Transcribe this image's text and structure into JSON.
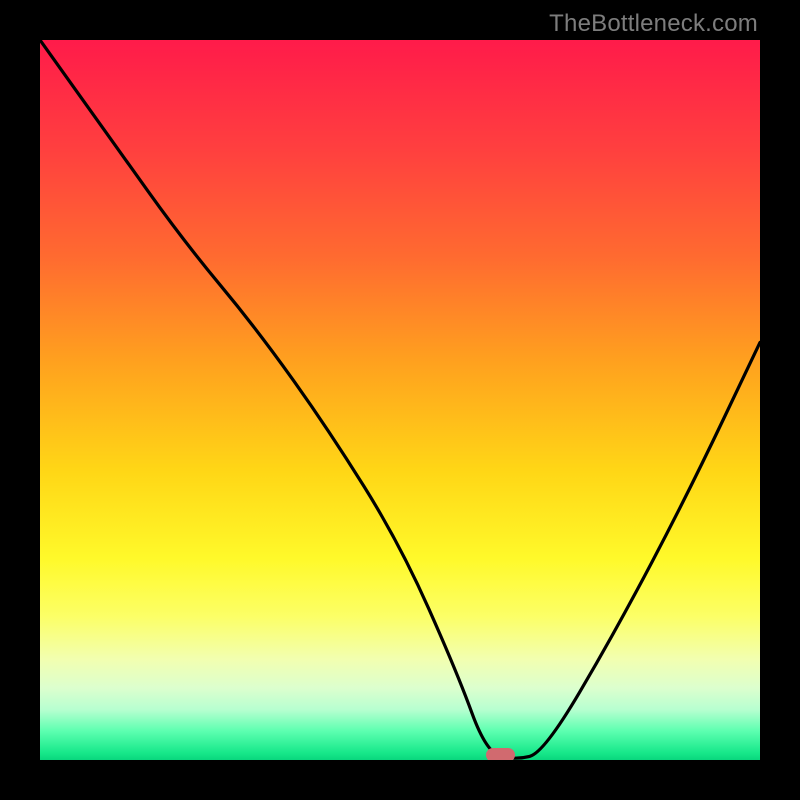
{
  "watermark": "TheBottleneck.com",
  "chart_data": {
    "type": "line",
    "title": "",
    "xlabel": "",
    "ylabel": "",
    "xlim": [
      0,
      100
    ],
    "ylim": [
      0,
      100
    ],
    "series": [
      {
        "name": "bottleneck-curve",
        "x": [
          0,
          10,
          20,
          30,
          40,
          50,
          58,
          62,
          66,
          70,
          80,
          90,
          100
        ],
        "y": [
          100,
          86,
          72,
          60,
          46,
          30,
          12,
          1,
          0,
          1,
          18,
          37,
          58
        ]
      }
    ],
    "optimal_marker": {
      "x": 64,
      "width": 4,
      "y": 0
    },
    "gradient_stops": [
      {
        "pct": 0,
        "color": "#ff1b4a"
      },
      {
        "pct": 15,
        "color": "#ff3f3f"
      },
      {
        "pct": 30,
        "color": "#ff6a30"
      },
      {
        "pct": 45,
        "color": "#ffa21e"
      },
      {
        "pct": 60,
        "color": "#ffd716"
      },
      {
        "pct": 72,
        "color": "#fff92a"
      },
      {
        "pct": 80,
        "color": "#fcff66"
      },
      {
        "pct": 86,
        "color": "#f2ffb0"
      },
      {
        "pct": 90,
        "color": "#dcffce"
      },
      {
        "pct": 93,
        "color": "#b7ffd0"
      },
      {
        "pct": 96,
        "color": "#5cffb0"
      },
      {
        "pct": 99,
        "color": "#17e88a"
      },
      {
        "pct": 100,
        "color": "#09d67d"
      }
    ]
  }
}
